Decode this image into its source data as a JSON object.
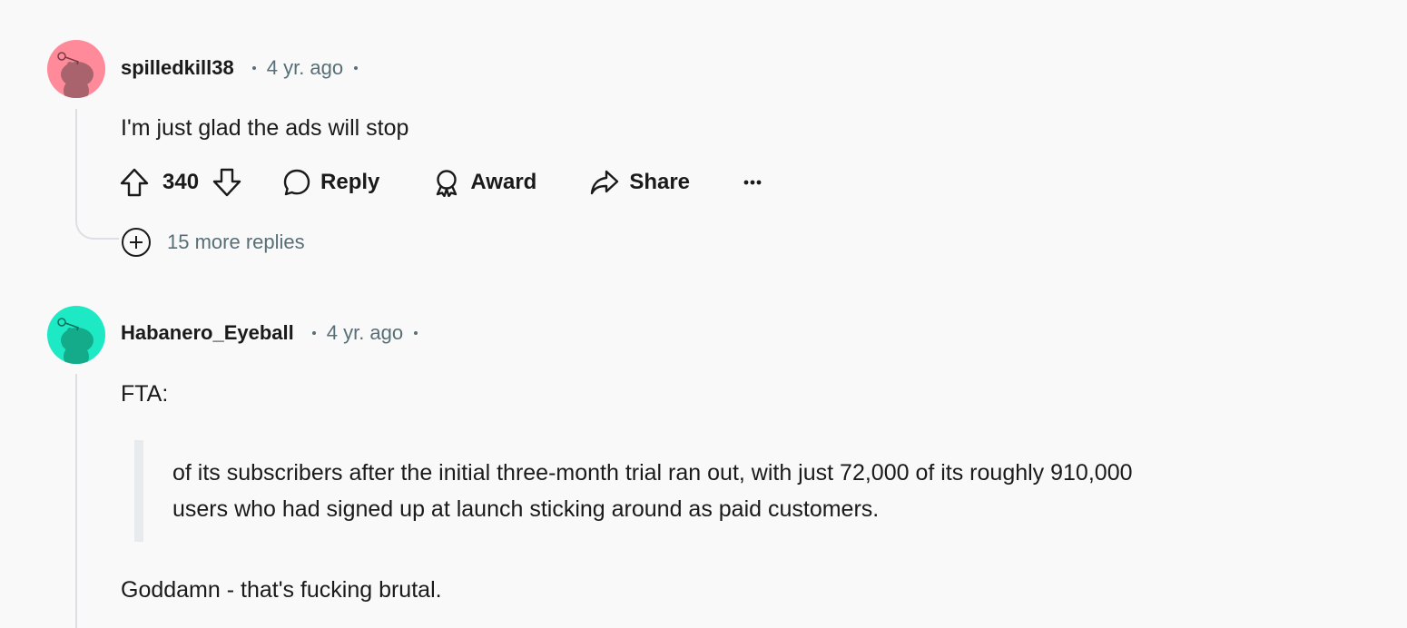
{
  "comments": [
    {
      "username": "spilledkill38",
      "time": "4 yr. ago",
      "avatar_color": "#ff8a9a",
      "avatar_icon": "snoo-avatar-icon",
      "body": "I'm just glad the ads will stop",
      "votes": "340",
      "actions": {
        "reply": "Reply",
        "award": "Award",
        "share": "Share",
        "more": "overflow-menu-icon"
      },
      "more_replies": "15 more replies"
    },
    {
      "username": "Habanero_Eyeball",
      "time": "4 yr. ago",
      "avatar_color": "#1de9c4",
      "avatar_icon": "snoo-avatar-icon",
      "body_intro": "FTA:",
      "quote_lines": [
        "of its subscribers after the initial three-month trial ran out, with just 72,000 of its roughly 910,000",
        "users who had signed up at launch sticking around as paid customers."
      ],
      "body_closing": "Goddamn - that's fucking brutal."
    }
  ]
}
